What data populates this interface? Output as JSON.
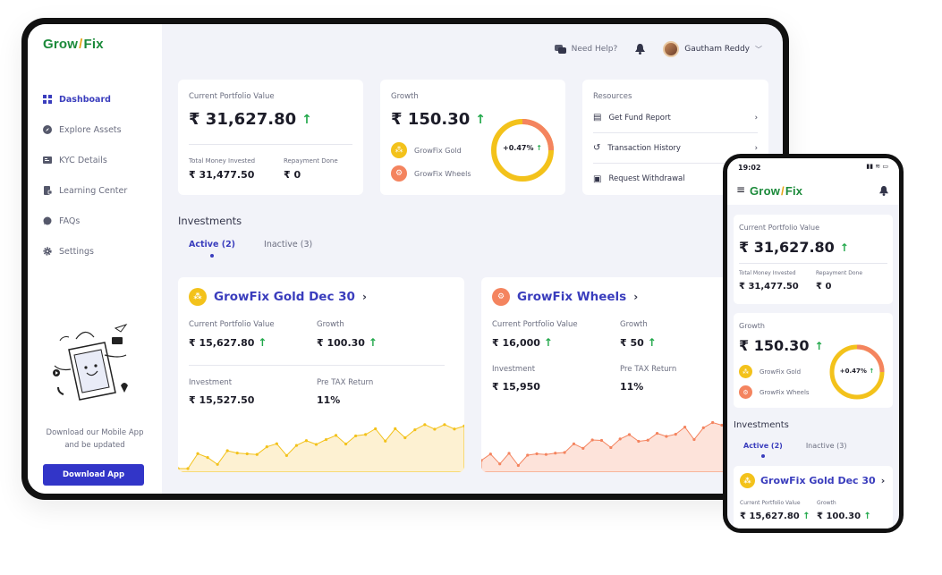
{
  "brand": {
    "part1": "Grow",
    "slash": "/",
    "part2": "Fix"
  },
  "sidebar": {
    "items": [
      {
        "label": "Dashboard",
        "icon": "grid-icon",
        "active": true
      },
      {
        "label": "Explore Assets",
        "icon": "compass-icon"
      },
      {
        "label": "KYC Details",
        "icon": "id-card-icon"
      },
      {
        "label": "Learning Center",
        "icon": "book-icon"
      },
      {
        "label": "FAQs",
        "icon": "chat-icon"
      },
      {
        "label": "Settings",
        "icon": "gear-icon"
      }
    ],
    "download_text": "Download our Mobile App and be updated",
    "download_button": "Download App"
  },
  "topbar": {
    "help": "Need Help?",
    "user": "Gautham Reddy"
  },
  "portfolio": {
    "label": "Current Portfolio Value",
    "value": "₹ 31,627.80",
    "invested_label": "Total Money Invested",
    "invested": "₹ 31,477.50",
    "repay_label": "Repayment Done",
    "repay": "₹ 0"
  },
  "growth": {
    "label": "Growth",
    "value": "₹ 150.30",
    "percent": "+0.47%",
    "legend": [
      "GrowFix Gold",
      "GrowFix Wheels"
    ]
  },
  "resources": {
    "label": "Resources",
    "items": [
      "Get Fund Report",
      "Transaction History",
      "Request Withdrawal"
    ]
  },
  "investments": {
    "label": "Investments",
    "tabs": [
      "Active (2)",
      "Inactive (3)"
    ]
  },
  "inv_cards": [
    {
      "title": "GrowFix Gold Dec 30",
      "cpv_label": "Current Portfolio Value",
      "cpv": "₹ 15,627.80",
      "growth_label": "Growth",
      "growth": "₹ 100.30",
      "inv_label": "Investment",
      "inv": "₹ 15,527.50",
      "ret_label": "Pre TAX Return",
      "ret": "11%"
    },
    {
      "title": "GrowFix Wheels",
      "cpv_label": "Current Portfolio Value",
      "cpv": "₹ 16,000",
      "growth_label": "Growth",
      "growth": "₹ 50",
      "inv_label": "Investment",
      "inv": "₹ 15,950",
      "ret_label": "Pre TAX Return",
      "ret": "11%"
    }
  ],
  "phone": {
    "time": "19:02",
    "portfolio_label": "Current Portfolio Value",
    "portfolio": "₹ 31,627.80",
    "invested_label": "Total Money Invested",
    "invested": "₹ 31,477.50",
    "repay_label": "Repayment Done",
    "repay": "₹ 0",
    "growth_label": "Growth",
    "growth": "₹ 150.30",
    "percent": "+0.47%",
    "legend": [
      "GrowFix Gold",
      "GrowFix Wheels"
    ],
    "inv_label": "Investments",
    "tabs": [
      "Active (2)",
      "Inactive (3)"
    ],
    "card_title": "GrowFix Gold Dec 30",
    "cpv_label": "Current Portfolio Value",
    "cpv": "₹ 15,627.80",
    "g_label": "Growth",
    "g": "₹ 100.30"
  },
  "colors": {
    "accent": "#3a3dbd",
    "gold": "#f3c21b",
    "wheels": "#f4845f",
    "green": "#22a84b"
  }
}
